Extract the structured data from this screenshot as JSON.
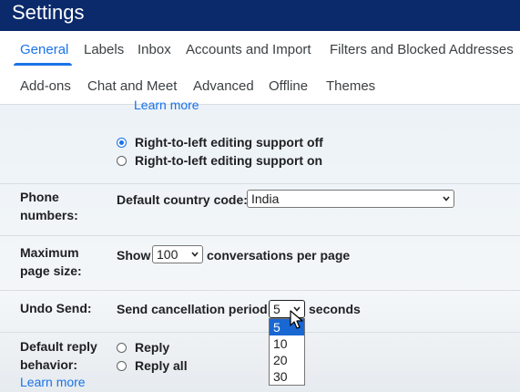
{
  "window": {
    "title": "Settings"
  },
  "tabs": {
    "row1": [
      "General",
      "Labels",
      "Inbox",
      "Accounts and Import",
      "Filters and Blocked Addresses"
    ],
    "row2": [
      "Add-ons",
      "Chat and Meet",
      "Advanced",
      "Offline",
      "Themes"
    ],
    "active": "General"
  },
  "rtl": {
    "learn_more": "Learn more",
    "off_label": "Right-to-left editing support off",
    "on_label": "Right-to-left editing support on",
    "selected": "off"
  },
  "phone": {
    "label": "Phone numbers:",
    "prompt": "Default country code:",
    "value": "India"
  },
  "page_size": {
    "label": "Maximum page size:",
    "show": "Show",
    "value": "100",
    "suffix": "conversations per page"
  },
  "undo_send": {
    "label": "Undo Send:",
    "prompt": "Send cancellation period:",
    "value": "5",
    "suffix": "seconds",
    "options": [
      "5",
      "10",
      "20",
      "30"
    ],
    "highlighted": "5"
  },
  "reply": {
    "label": "Default reply behavior:",
    "options": [
      "Reply",
      "Reply all"
    ],
    "learn_more": "Learn more"
  },
  "icons": {
    "caret": "chevron-down-icon",
    "cursor": "mouse-pointer-icon"
  },
  "colors": {
    "accent": "#1a73e8",
    "header": "#0b2a6b",
    "selection": "#1967d2"
  }
}
